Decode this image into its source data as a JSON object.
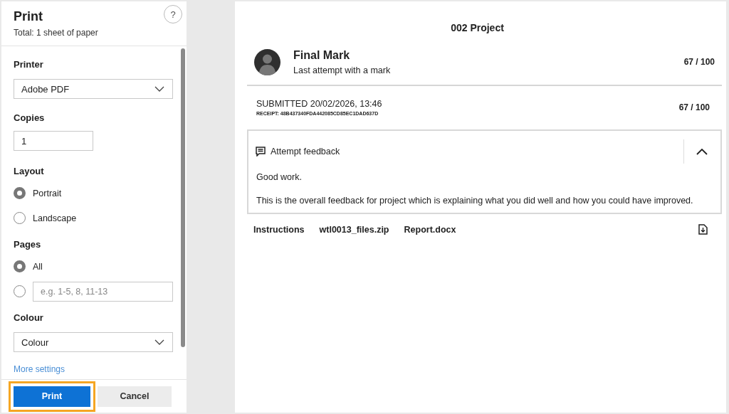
{
  "panel": {
    "title": "Print",
    "subtitle": "Total: 1 sheet of paper",
    "help": "?",
    "printer": {
      "label": "Printer",
      "value": "Adobe PDF"
    },
    "copies": {
      "label": "Copies",
      "value": "1"
    },
    "layout": {
      "label": "Layout",
      "options": [
        {
          "label": "Portrait",
          "selected": true
        },
        {
          "label": "Landscape",
          "selected": false
        }
      ]
    },
    "pages": {
      "label": "Pages",
      "options": [
        {
          "kind": "label",
          "label": "All",
          "selected": true
        },
        {
          "kind": "field",
          "placeholder": "e.g. 1-5, 8, 11-13",
          "selected": false
        }
      ]
    },
    "colour": {
      "label": "Colour",
      "value": "Colour"
    },
    "more_settings": "More settings",
    "buttons": [
      {
        "label": "Print",
        "kind": "primary",
        "focused": true
      },
      {
        "label": "Cancel",
        "kind": "secondary",
        "focused": false
      }
    ]
  },
  "preview": {
    "title": "002 Project",
    "mark": {
      "title": "Final Mark",
      "subtitle": "Last attempt with a mark",
      "score": "67 / 100"
    },
    "submission": {
      "submitted": "SUBMITTED 20/02/2026, 13:46",
      "receipt": "RECEIPT: 48B437340FDA442085CD85EC1DAD637D",
      "score": "67 / 100"
    },
    "feedback": {
      "title": "Attempt feedback",
      "expanded": true,
      "paragraphs": [
        "Good work.",
        "This is the overall feedback for project which is explaining what you did well and how you could have improved."
      ]
    },
    "files": [
      "Instructions",
      "wtl0013_files.zip",
      "Report.docx"
    ]
  }
}
